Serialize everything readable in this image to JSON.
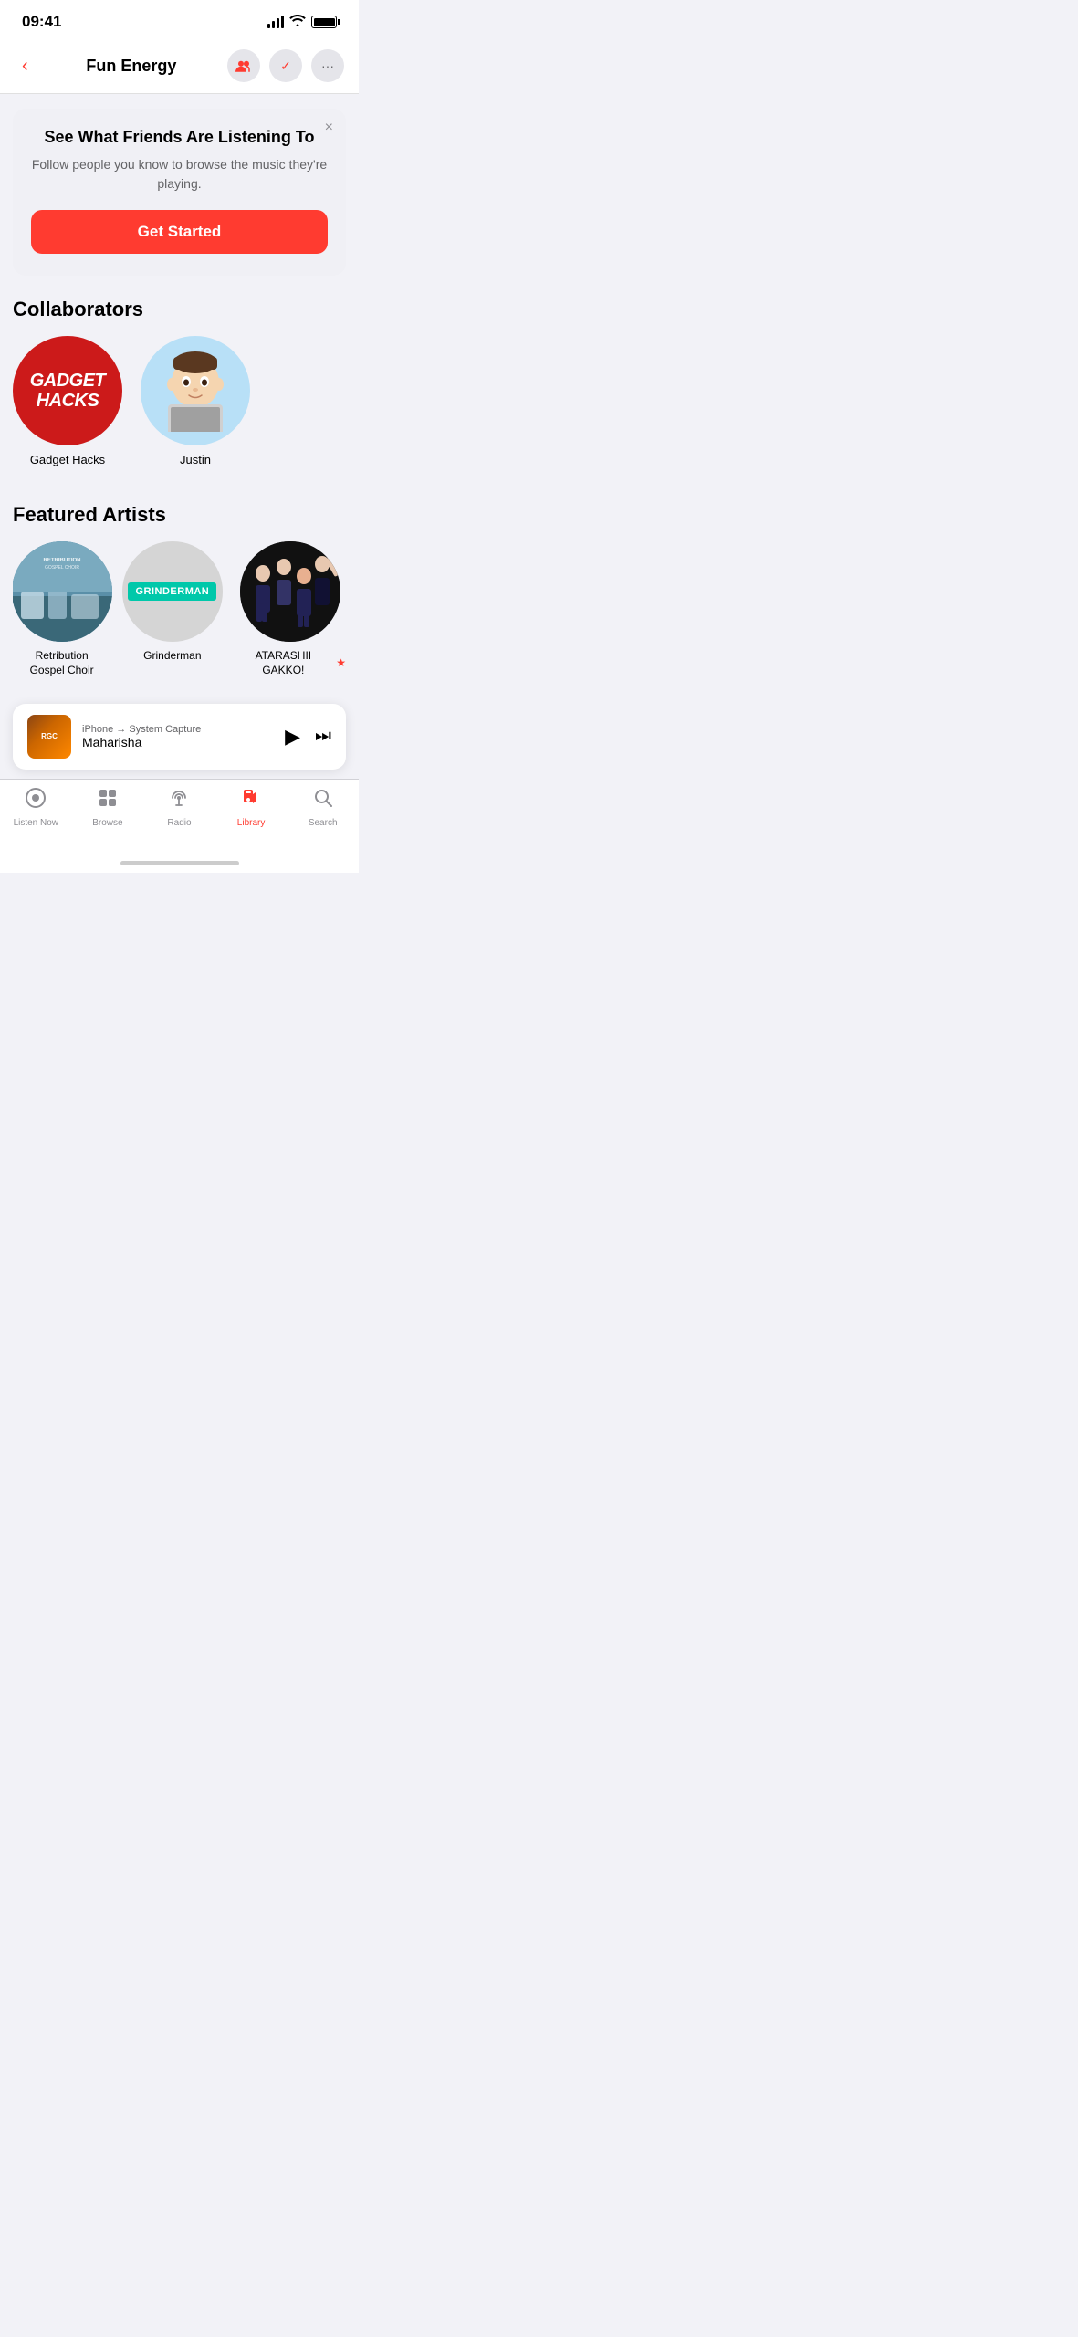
{
  "statusBar": {
    "time": "09:41"
  },
  "navBar": {
    "title": "Fun Energy",
    "backLabel": "‹",
    "addPeopleLabel": "👥",
    "checkLabel": "✓",
    "moreLabel": "···"
  },
  "socialCard": {
    "title": "See What Friends Are Listening To",
    "description": "Follow people you know to browse the music they're playing.",
    "ctaLabel": "Get Started",
    "closeLabel": "×"
  },
  "collaborators": {
    "sectionTitle": "Collaborators",
    "items": [
      {
        "name": "Gadget Hacks",
        "type": "gadget-hacks"
      },
      {
        "name": "Justin",
        "type": "justin"
      }
    ]
  },
  "featuredArtists": {
    "sectionTitle": "Featured Artists",
    "items": [
      {
        "name": "Retribution\nGospel Choir",
        "type": "retribution",
        "featured": false
      },
      {
        "name": "Grinderman",
        "type": "grinderman",
        "featured": false
      },
      {
        "name": "ATARASHII GAKKO!",
        "type": "atarashii",
        "featured": true
      }
    ]
  },
  "miniPlayer": {
    "source": "iPhone → System Capture",
    "title": "Maharisha",
    "artText": "RGC"
  },
  "tabBar": {
    "items": [
      {
        "label": "Listen Now",
        "icon": "▶",
        "active": false
      },
      {
        "label": "Browse",
        "icon": "⊞",
        "active": false
      },
      {
        "label": "Radio",
        "icon": "📡",
        "active": false
      },
      {
        "label": "Library",
        "icon": "♪",
        "active": true
      },
      {
        "label": "Search",
        "icon": "🔍",
        "active": false
      }
    ]
  }
}
